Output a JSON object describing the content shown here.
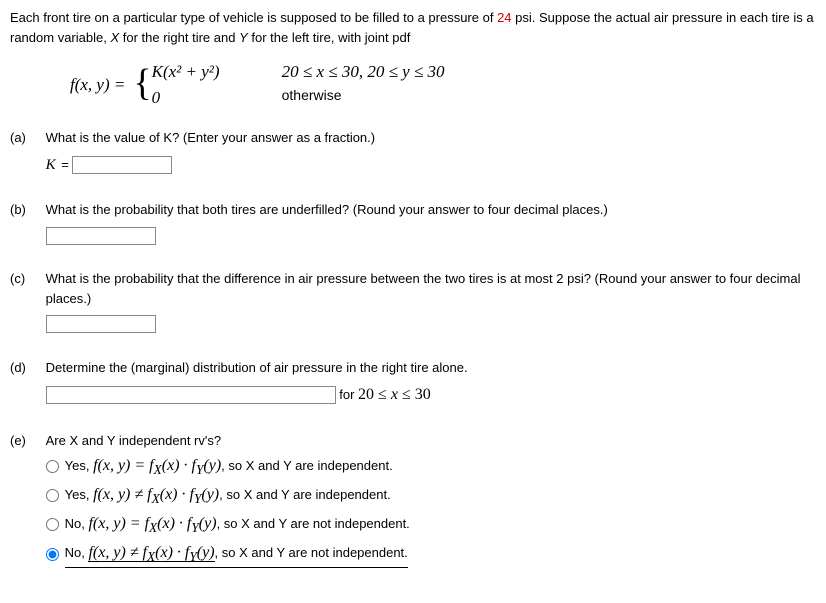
{
  "intro": {
    "line1a": "Each front tire on a particular type of vehicle is supposed to be filled to a pressure of ",
    "psi": "24",
    "line1b": " psi. Suppose the actual air pressure in each tire is a random variable, ",
    "xvar": "X",
    "line1c": " for the right tire and ",
    "yvar": "Y",
    "line1d": " for the left tire, with joint pdf"
  },
  "formula": {
    "lhs": "f(x, y)  =  ",
    "top_left": "K(x² + y²)",
    "top_right": "20 ≤ x ≤ 30, 20 ≤ y ≤ 30",
    "bot_left": "0",
    "bot_right": "otherwise"
  },
  "a": {
    "label": "(a)",
    "text": "What is the value of K? (Enter your answer as a fraction.)",
    "klabel": "K",
    "equals": " = "
  },
  "b": {
    "label": "(b)",
    "text": "What is the probability that both tires are underfilled? (Round your answer to four decimal places.)"
  },
  "c": {
    "label": "(c)",
    "text": "What is the probability that the difference in air pressure between the two tires is at most 2 psi? (Round your answer to four decimal places.)"
  },
  "d": {
    "label": "(d)",
    "text": "Determine the (marginal) distribution of air pressure in the right tire alone.",
    "for": " for ",
    "domain": "20 ≤ x ≤ 30"
  },
  "e": {
    "label": "(e)",
    "text": "Are X and Y independent rv's?",
    "opt1a": "Yes,  ",
    "opt1m": "f(x, y) = f",
    "opt1sx": "X",
    "opt1m2": "(x) · f",
    "opt1sy": "Y",
    "opt1m3": "(y)",
    "opt1b": ", so X and Y are independent.",
    "opt2a": "Yes,  ",
    "opt2m": "f(x, y) ≠ f",
    "opt2b": ", so X and Y are independent.",
    "opt3a": "No,  ",
    "opt3m": "f(x, y) = f",
    "opt3b": ", so X and Y are not independent.",
    "opt4a": "No,  ",
    "opt4m": "f(x, y) ≠ f",
    "opt4b": ", so X and Y are not independent."
  }
}
